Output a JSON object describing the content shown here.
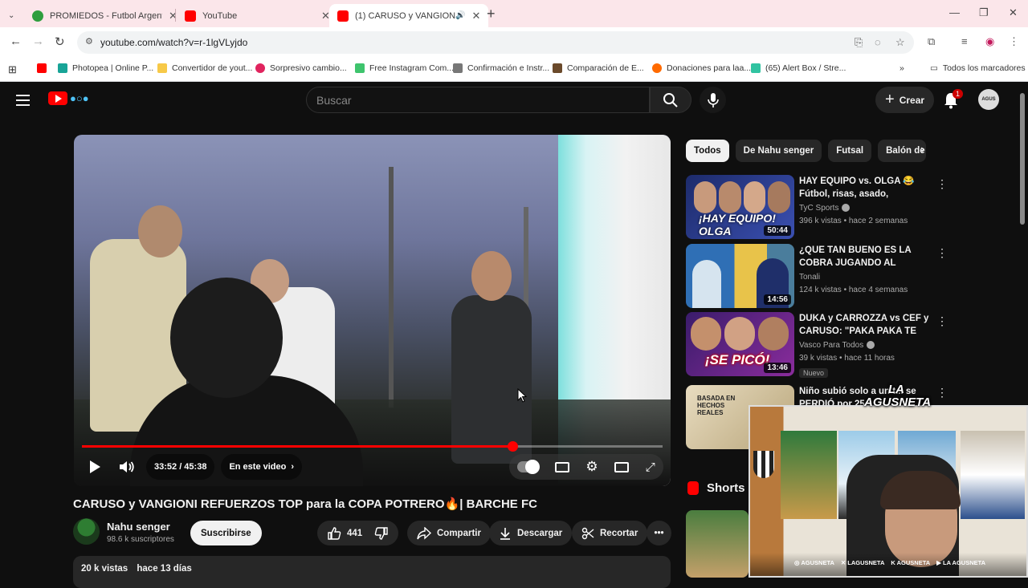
{
  "browser": {
    "tabs": [
      {
        "title": "PROMIEDOS - Futbol Argentino",
        "favicon_color": "#2e9e3e"
      },
      {
        "title": "YouTube",
        "favicon_color": "#ff0000"
      },
      {
        "title": "(1) CARUSO y VANGIONI R",
        "favicon_color": "#ff0000"
      }
    ],
    "url": "youtube.com/watch?v=r-1lgVLyjdo",
    "bookmarks": [
      {
        "label": "",
        "color": "#ff0000"
      },
      {
        "label": "Photopea | Online P...",
        "color": "#18a497"
      },
      {
        "label": "Convertidor de yout...",
        "color": "#f7c948"
      },
      {
        "label": "Sorpresivo cambio...",
        "color": "#e0245e"
      },
      {
        "label": "Free Instagram Com...",
        "color": "#3ec46d"
      },
      {
        "label": "Confirmación e Instr...",
        "color": "#777777"
      },
      {
        "label": "Comparación de E...",
        "color": "#6b4a2b"
      },
      {
        "label": "Donaciones para laa...",
        "color": "#ff6a00"
      },
      {
        "label": "(65) Alert Box / Stre...",
        "color": "#31c3a1"
      }
    ],
    "all_bookmarks": "Todos los marcadores"
  },
  "header": {
    "search_placeholder": "Buscar",
    "create_label": "Crear",
    "notification_count": "1",
    "avatar_text": "AGUS"
  },
  "player": {
    "time": "33:52 / 45:38",
    "progress": 0.742,
    "in_video_label": "En este video"
  },
  "video": {
    "title": "CARUSO y VANGIONI REFUERZOS TOP para la COPA POTRERO🔥| BARCHE FC",
    "channel": "Nahu senger",
    "subscribers": "98.6 k suscriptores",
    "subscribe_label": "Suscribirse",
    "likes": "441",
    "share_label": "Compartir",
    "download_label": "Descargar",
    "clip_label": "Recortar",
    "views": "20 k vistas",
    "date": "hace 13 días"
  },
  "chips": [
    "Todos",
    "De Nahu senger",
    "Futsal",
    "Balón de f"
  ],
  "recommendations": [
    {
      "title": "HAY EQUIPO vs. OLGA 😂 Fútbol, risas, asado, anécdota...",
      "channel": "TyC Sports",
      "verified": true,
      "meta": "396 k vistas • hace 2 semanas",
      "duration": "50:44",
      "badge": "",
      "colors": [
        "#1d2b6b",
        "#3a4fb0"
      ],
      "overlay": "¡HAY EQUIPO! OLGA"
    },
    {
      "title": "¿QUE TAN BUENO ES LA COBRA JUGANDO AL FUTBOL?",
      "channel": "Tonali",
      "verified": false,
      "meta": "124 k vistas • hace 4 semanas",
      "duration": "14:56",
      "badge": "",
      "colors": [
        "#2f6fb5",
        "#e8c34a"
      ],
      "overlay": ""
    },
    {
      "title": "DUKA y CARROZZA vs CEF y CARUSO: \"PAKA PAKA TE HIZ...",
      "channel": "Vasco Para Todos",
      "verified": true,
      "meta": "39 k vistas • hace 11 horas",
      "duration": "13:46",
      "badge": "Nuevo",
      "colors": [
        "#3a1c6b",
        "#8a2c9c"
      ],
      "overlay": "¡SE PICÓ!"
    },
    {
      "title": "Niño subió solo a un t... se PERDIÓ por 25 ...",
      "channel": "",
      "verified": false,
      "meta": "",
      "duration": "",
      "badge": "",
      "colors": [
        "#e8dcc0",
        "#b8a57a"
      ],
      "overlay": "BASADA EN HECHOS REALES"
    }
  ],
  "shorts_label": "Shorts",
  "webcam": {
    "logo": "LA AGUSNETA",
    "socials": [
      "AGUSNETA",
      "LAGUSNETA",
      "AGUSNETA",
      "LA AGUSNETA"
    ]
  }
}
